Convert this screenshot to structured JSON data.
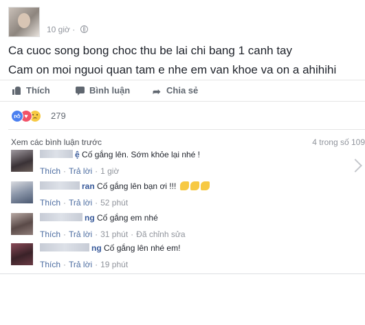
{
  "post": {
    "time": "10 giờ · ",
    "privacy_icon": "globe-icon",
    "lines": [
      "Ca cuoc song bong choc thu be lai chi bang 1 canh tay",
      "Cam on moi nguoi quan tam e nhe em van khoe va on a ahihihi"
    ]
  },
  "actions": {
    "like": "Thích",
    "comment": "Bình luận",
    "share": "Chia sẻ"
  },
  "reactions": {
    "icons": [
      "like-reaction-icon",
      "love-reaction-icon",
      "sad-reaction-icon"
    ],
    "count": "279"
  },
  "comments_header": {
    "view_previous": "Xem các bình luận trước",
    "pager": "4 trong số 109"
  },
  "comments": [
    {
      "name_suffix": "ệ",
      "text": "Cố gắng lên. Sớm khỏe lại nhé !",
      "like": "Thích",
      "reply": "Trả lời",
      "time": "1 giờ",
      "edited": ""
    },
    {
      "name_suffix": "ran",
      "text": "Cố gắng lên bạn ơi !!!",
      "like": "Thích",
      "reply": "Trả lời",
      "time": "52 phút",
      "edited": ""
    },
    {
      "name_suffix": "ng",
      "text": "Cố gắng em nhé",
      "like": "Thích",
      "reply": "Trả lời",
      "time": "31 phút",
      "edited": "Đã chỉnh sửa"
    },
    {
      "name_suffix": "ng",
      "text": "Cố gắng lên nhé em!",
      "like": "Thích",
      "reply": "Trả lời",
      "time": "19 phút",
      "edited": ""
    }
  ],
  "colors": {
    "link": "#365899",
    "meta": "#90949c",
    "text": "#1d2129"
  }
}
